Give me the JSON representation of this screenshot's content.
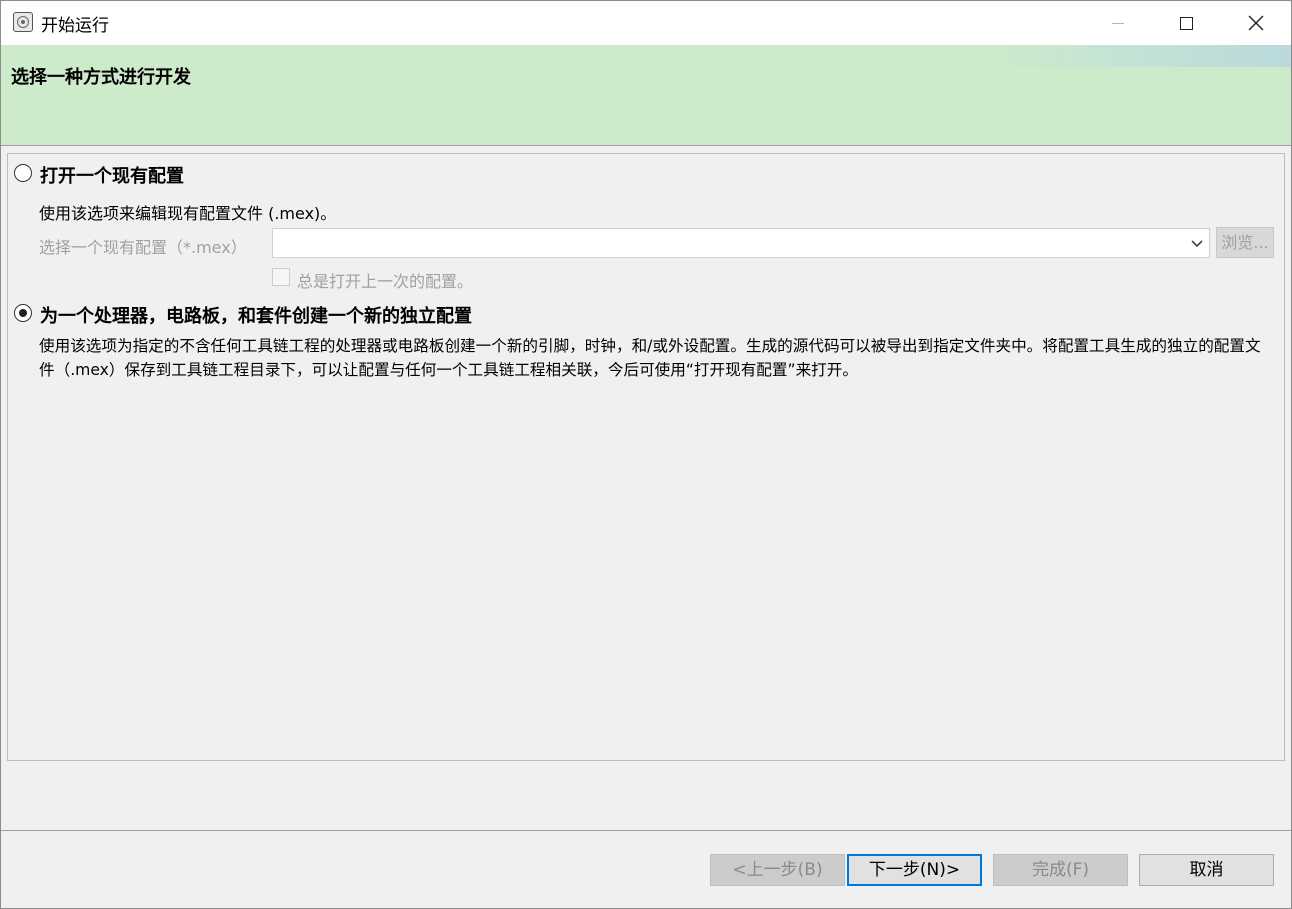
{
  "window": {
    "title": "开始运行"
  },
  "banner": {
    "title": "选择一种方式进行开发"
  },
  "option_open": {
    "label": "打开一个现有配置",
    "selected": false,
    "description": "使用该选项来编辑现有配置文件 (.mex)。",
    "select_label": "选择一个现有配置（*.mex）",
    "select_value": "",
    "browse_label": "浏览...",
    "checkbox_label": "总是打开上一次的配置。",
    "checkbox_checked": false
  },
  "option_new": {
    "label": "为一个处理器，电路板，和套件创建一个新的独立配置",
    "selected": true,
    "description": "使用该选项为指定的不含任何工具链工程的处理器或电路板创建一个新的引脚，时钟，和/或外设配置。生成的源代码可以被导出到指定文件夹中。将配置工具生成的独立的配置文件（.mex）保存到工具链工程目录下，可以让配置与任何一个工具链工程相关联，今后可使用“打开现有配置”来打开。"
  },
  "buttons": {
    "back": "<上一步(B)",
    "next": "下一步(N)>",
    "finish": "完成(F)",
    "cancel": "取消"
  }
}
